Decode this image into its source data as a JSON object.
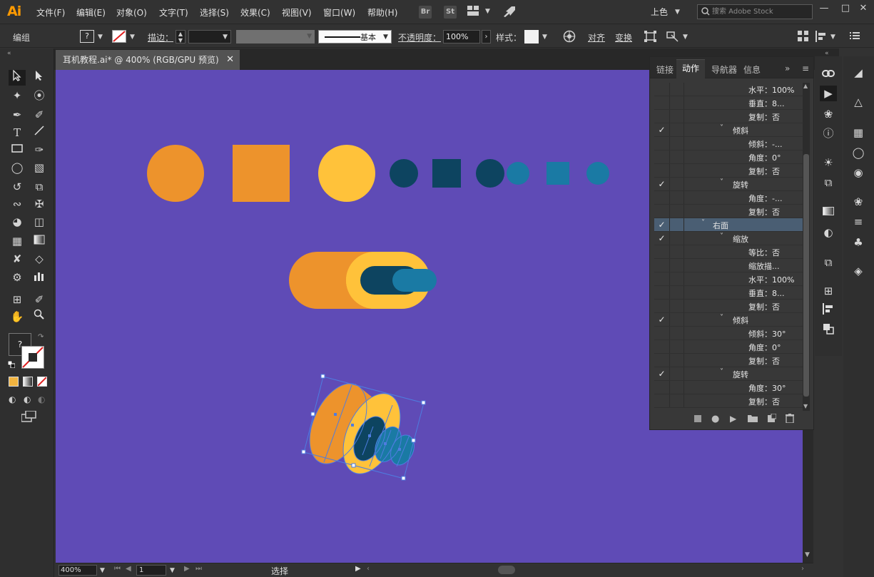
{
  "app": {
    "logo": "Ai",
    "menu": [
      "文件(F)",
      "编辑(E)",
      "对象(O)",
      "文字(T)",
      "选择(S)",
      "效果(C)",
      "视图(V)",
      "窗口(W)",
      "帮助(H)"
    ],
    "bridge": "Br",
    "stock": "St",
    "workspace": "上色",
    "search_placeholder": "搜索 Adobe Stock",
    "window_buttons": [
      "—",
      "□",
      "✕"
    ]
  },
  "control": {
    "selection_label": "编组",
    "stroke_label": "描边：",
    "stroke_style": "基本",
    "opacity_label": "不透明度：",
    "opacity_value": "100%",
    "style_label": "样式：",
    "align_label": "对齐",
    "transform_label": "变换",
    "fill_placeholder": "?"
  },
  "document": {
    "tab_title": "耳机教程.ai* @ 400% (RGB/GPU 预览)",
    "close": "✕"
  },
  "status": {
    "zoom": "400%",
    "artboard": "1",
    "tool": "选择"
  },
  "panel": {
    "tabs": [
      "链接",
      "动作",
      "导航器",
      "信息"
    ],
    "active_tab": "动作",
    "more": "»",
    "menu": "≡",
    "rows": [
      {
        "check": "",
        "tri": "",
        "text": "水平：100%",
        "indent": 2
      },
      {
        "check": "",
        "tri": "",
        "text": "垂直：8...",
        "indent": 2
      },
      {
        "check": "",
        "tri": "",
        "text": "复制：否",
        "indent": 2
      },
      {
        "check": "✓",
        "tri": "˅",
        "text": "倾斜",
        "indent": 1
      },
      {
        "check": "",
        "tri": "",
        "text": "倾斜：-...",
        "indent": 2
      },
      {
        "check": "",
        "tri": "",
        "text": "角度：0°",
        "indent": 2
      },
      {
        "check": "",
        "tri": "",
        "text": "复制：否",
        "indent": 2
      },
      {
        "check": "✓",
        "tri": "˅",
        "text": "旋转",
        "indent": 1
      },
      {
        "check": "",
        "tri": "",
        "text": "角度：-...",
        "indent": 2
      },
      {
        "check": "",
        "tri": "",
        "text": "复制：否",
        "indent": 2
      },
      {
        "check": "✓",
        "tri": "˅",
        "text": "右面",
        "indent": 0,
        "highlight": true
      },
      {
        "check": "✓",
        "tri": "˅",
        "text": "缩放",
        "indent": 1
      },
      {
        "check": "",
        "tri": "",
        "text": "等比：否",
        "indent": 2
      },
      {
        "check": "",
        "tri": "",
        "text": "缩放描...",
        "indent": 2
      },
      {
        "check": "",
        "tri": "",
        "text": "水平：100%",
        "indent": 2
      },
      {
        "check": "",
        "tri": "",
        "text": "垂直：8...",
        "indent": 2
      },
      {
        "check": "",
        "tri": "",
        "text": "复制：否",
        "indent": 2
      },
      {
        "check": "✓",
        "tri": "˅",
        "text": "倾斜",
        "indent": 1
      },
      {
        "check": "",
        "tri": "",
        "text": "倾斜：30°",
        "indent": 2
      },
      {
        "check": "",
        "tri": "",
        "text": "角度：0°",
        "indent": 2
      },
      {
        "check": "",
        "tri": "",
        "text": "复制：否",
        "indent": 2
      },
      {
        "check": "✓",
        "tri": "˅",
        "text": "旋转",
        "indent": 1
      },
      {
        "check": "",
        "tri": "",
        "text": "角度：30°",
        "indent": 2
      },
      {
        "check": "",
        "tri": "",
        "text": "复制：否",
        "indent": 2
      }
    ]
  },
  "colors": {
    "canvas": "#5f4bb6",
    "orange": "#ed932c",
    "yellow": "#ffc23a",
    "navy": "#0d4460",
    "teal": "#1a7aa4",
    "selection": "#4e7de0"
  }
}
